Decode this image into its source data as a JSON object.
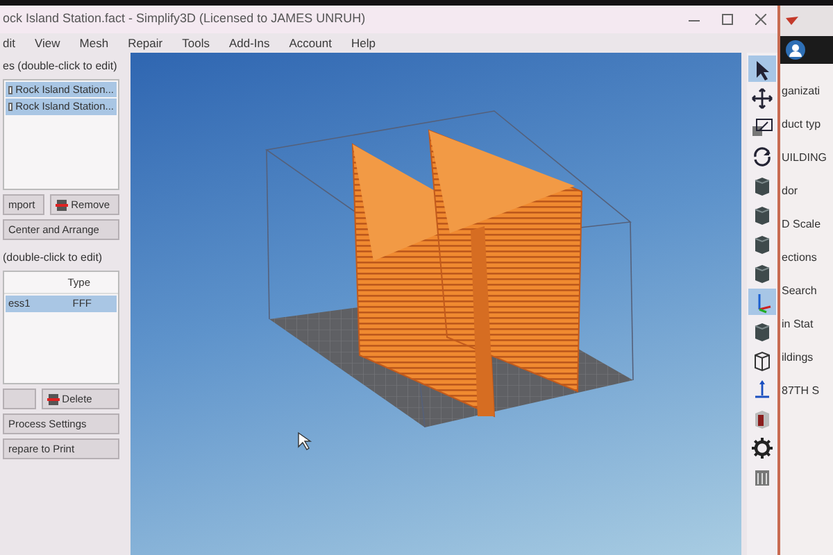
{
  "window": {
    "title": "ock Island Station.fact - Simplify3D (Licensed to JAMES UNRUH)"
  },
  "menu": [
    "dit",
    "View",
    "Mesh",
    "Repair",
    "Tools",
    "Add-Ins",
    "Account",
    "Help"
  ],
  "models": {
    "header": "es (double-click to edit)",
    "items": [
      {
        "label": "Rock Island Station...",
        "selected": true
      },
      {
        "label": "Rock Island Station...",
        "selected": true
      }
    ],
    "buttons": [
      {
        "label": "mport",
        "kind": "plain"
      },
      {
        "label": "Remove",
        "kind": "remove"
      }
    ],
    "arrange_button": "Center and Arrange"
  },
  "processes": {
    "header": "(double-click to edit)",
    "type_header": "Type",
    "rows": [
      {
        "name": "ess1",
        "type": "FFF",
        "selected": true
      }
    ],
    "buttons": [
      {
        "kind": "plain"
      },
      {
        "label": "Delete",
        "kind": "remove"
      }
    ],
    "settings_button": "Process Settings",
    "print_button": "repare to Print"
  },
  "toolbar": [
    {
      "kind": "select",
      "selected": true
    },
    {
      "kind": "move",
      "selected": false
    },
    {
      "kind": "scale",
      "selected": false
    },
    {
      "kind": "rotate",
      "selected": false
    },
    {
      "kind": "cube",
      "selected": false
    },
    {
      "kind": "cube",
      "selected": false
    },
    {
      "kind": "cube",
      "selected": false
    },
    {
      "kind": "cube",
      "selected": false
    },
    {
      "kind": "axes",
      "selected": true
    },
    {
      "kind": "cube",
      "selected": false
    },
    {
      "kind": "wire",
      "selected": false
    },
    {
      "kind": "down",
      "selected": false
    },
    {
      "kind": "section",
      "selected": false
    },
    {
      "kind": "gear",
      "selected": false
    },
    {
      "kind": "bars",
      "selected": false
    }
  ],
  "background_window": {
    "lines": [
      "ganizati",
      "duct typ",
      "UILDING",
      "dor",
      "D Scale",
      "ections",
      "Search",
      "in Stat",
      "ildings",
      "87TH S"
    ]
  }
}
